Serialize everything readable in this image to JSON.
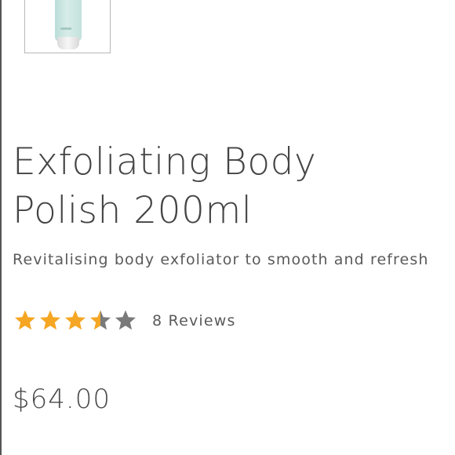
{
  "product": {
    "title": "Exfoliating Body Polish 200ml",
    "subtitle": "Revitalising body exfoliator to smooth and refresh",
    "rating": {
      "value": 3.5,
      "max": 5,
      "reviews_label": "8 Reviews",
      "filled_color": "#f5a623",
      "empty_color": "#7a7a7a"
    },
    "price": "$64.00",
    "thumbnail_icon": "product-tube-thumbnail"
  }
}
